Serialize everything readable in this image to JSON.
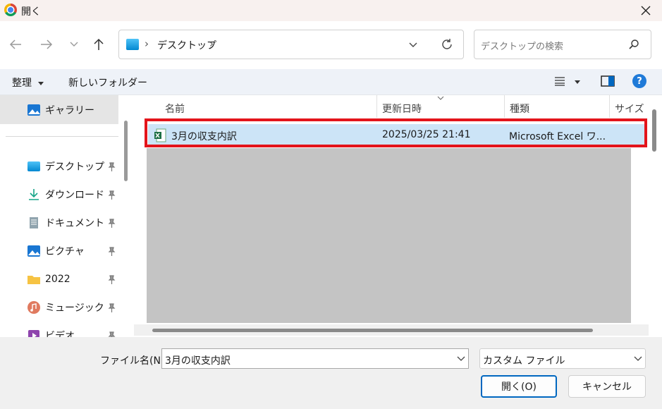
{
  "window": {
    "title": "開く"
  },
  "address": {
    "location": "デスクトップ",
    "sep": "›"
  },
  "search": {
    "placeholder": "デスクトップの検索"
  },
  "toolbar": {
    "organize": "整理",
    "new_folder": "新しいフォルダー",
    "help": "?"
  },
  "sidebar": {
    "items": [
      {
        "label": "ギャラリー",
        "icon": "gallery-icon"
      },
      {
        "label": "デスクトップ",
        "icon": "desktop-icon"
      },
      {
        "label": "ダウンロード",
        "icon": "download-icon"
      },
      {
        "label": "ドキュメント",
        "icon": "document-icon"
      },
      {
        "label": "ピクチャ",
        "icon": "picture-icon"
      },
      {
        "label": "2022",
        "icon": "folder-icon"
      },
      {
        "label": "ミュージック",
        "icon": "music-icon"
      },
      {
        "label": "ビデオ",
        "icon": "video-icon"
      }
    ]
  },
  "columns": {
    "name": "名前",
    "date": "更新日時",
    "type": "種類",
    "size": "サイズ"
  },
  "files": [
    {
      "name": "3月の収支内訳",
      "date": "2025/03/25 21:41",
      "type": "Microsoft Excel ワ...",
      "icon": "excel-file-icon"
    }
  ],
  "bottom": {
    "filename_label": "ファイル名(N):",
    "filename_value": "3月の収支内訳",
    "filter": "カスタム ファイル",
    "open": "開く(O)",
    "cancel": "キャンセル"
  },
  "colors": {
    "accent": "#0067c0",
    "selection": "#cce4f7",
    "highlight": "#e3141b"
  }
}
